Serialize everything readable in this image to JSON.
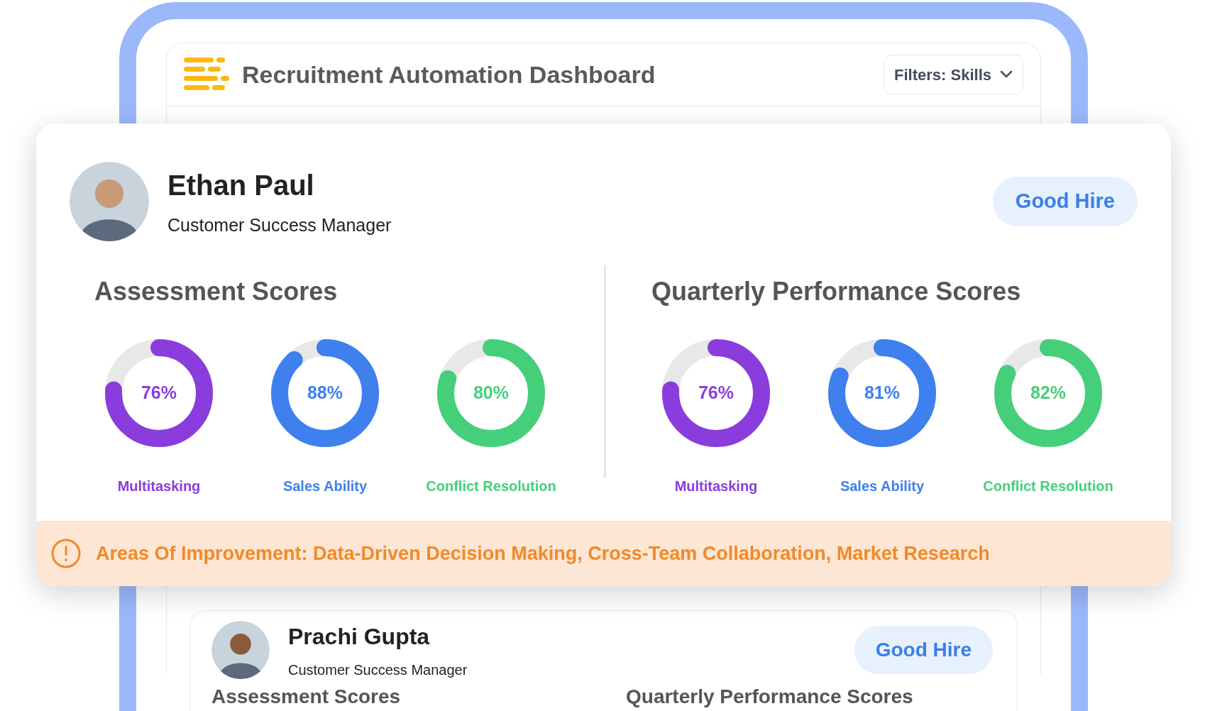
{
  "header": {
    "title": "Recruitment Automation Dashboard",
    "filter": "Filters: Skills"
  },
  "candidates": [
    {
      "name": "Ethan Paul",
      "role": "Customer Success Manager",
      "badge": "Good Hire",
      "sections": [
        {
          "title": "Assessment Scores",
          "scores": [
            {
              "value": "76%",
              "label": "Multitasking",
              "level": 0.76,
              "color": "#8a3ddc"
            },
            {
              "value": "88%",
              "label": "Sales Ability",
              "level": 0.88,
              "color": "#3d80ee"
            },
            {
              "value": "80%",
              "label": "Conflict Resolution",
              "level": 0.8,
              "color": "#46cf7b"
            }
          ]
        },
        {
          "title": "Quarterly Performance Scores",
          "scores": [
            {
              "value": "76%",
              "label": "Multitasking",
              "level": 0.76,
              "color": "#8a3ddc"
            },
            {
              "value": "81%",
              "label": "Sales Ability",
              "level": 0.81,
              "color": "#3d80ee"
            },
            {
              "value": "82%",
              "label": "Conflict Resolution",
              "level": 0.82,
              "color": "#46cf7b"
            }
          ]
        }
      ],
      "improvement": "Areas Of Improvement: Data-Driven Decision Making, Cross-Team Collaboration, Market Research"
    },
    {
      "name": "Prachi Gupta",
      "role": "Customer Success Manager",
      "badge": "Good Hire",
      "sections": [
        {
          "title": "Assessment Scores"
        },
        {
          "title": "Quarterly Performance Scores"
        }
      ]
    }
  ]
}
